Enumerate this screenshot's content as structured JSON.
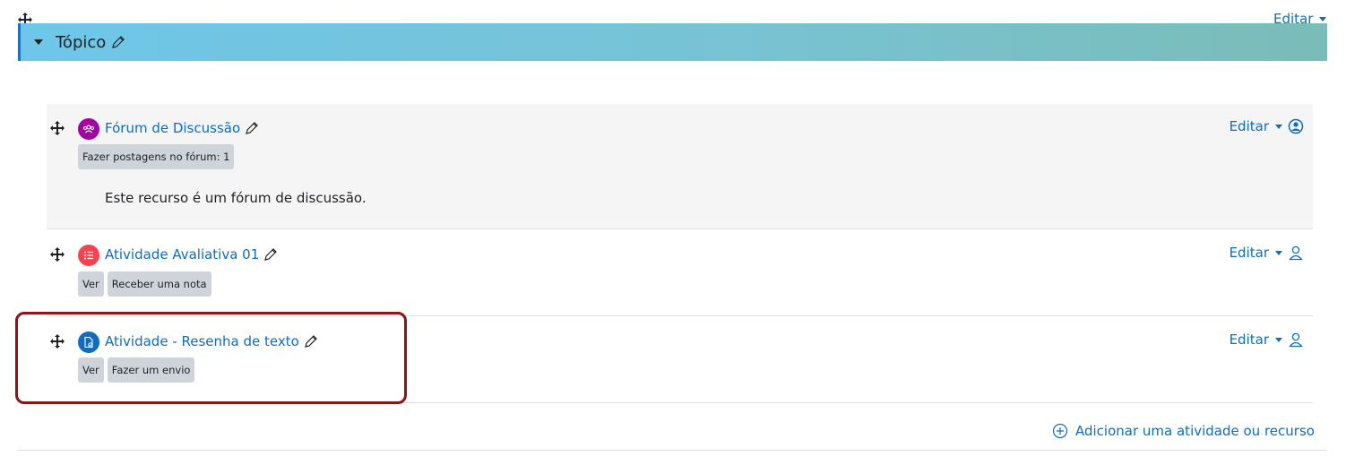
{
  "section": {
    "title": "Tópico",
    "edit_label": "Editar"
  },
  "activities": [
    {
      "title": "Fórum de Discussão",
      "icon": "forum-icon",
      "icon_color": "#a1059f",
      "badges": [
        "Fazer postagens no fórum: 1"
      ],
      "description": "Este recurso é um fórum de discussão.",
      "edit_label": "Editar",
      "status_icon": "user-circle-icon"
    },
    {
      "title": "Atividade Avaliativa 01",
      "icon": "quiz-icon",
      "icon_color": "#f7434f",
      "badges": [
        "Ver",
        "Receber uma nota"
      ],
      "edit_label": "Editar",
      "status_icon": "user-outline-icon"
    },
    {
      "title": "Atividade - Resenha de texto",
      "icon": "assignment-icon",
      "icon_color": "#0f6cbf",
      "badges": [
        "Ver",
        "Fazer um envio"
      ],
      "edit_label": "Editar",
      "status_icon": "user-outline-icon"
    }
  ],
  "add_activity_label": "Adicionar uma atividade ou recurso",
  "colors": {
    "accent": "#0f6cbf",
    "highlight_border": "#8b1414",
    "badge_bg": "#ced4da"
  }
}
